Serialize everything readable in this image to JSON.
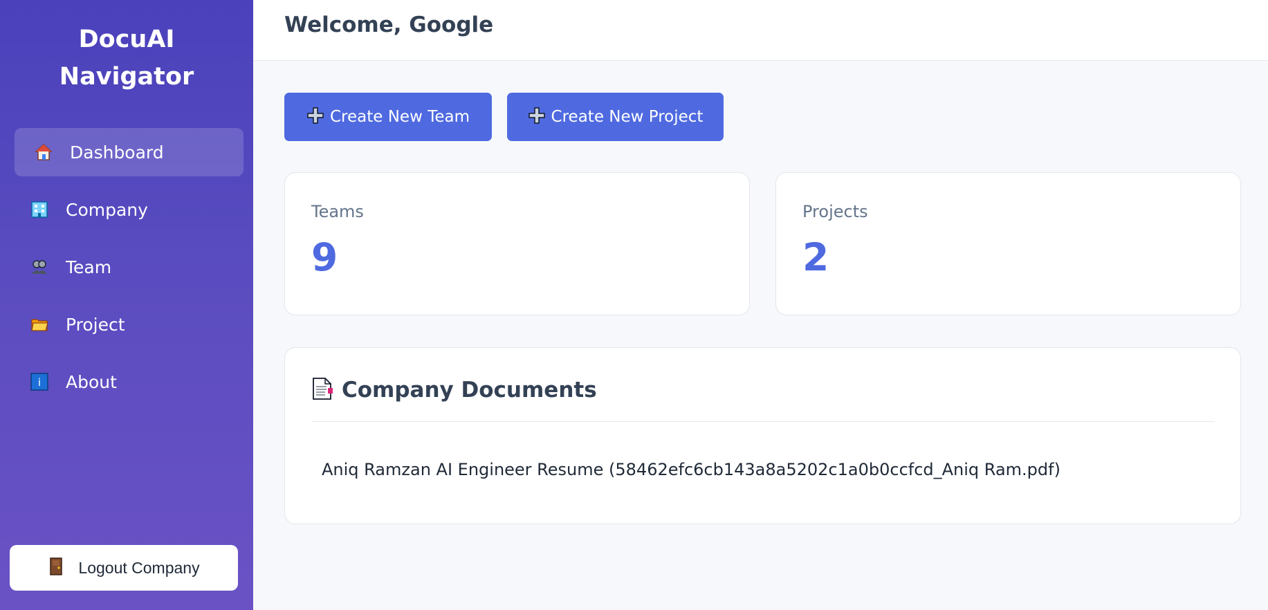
{
  "sidebar": {
    "brand_line1": "DocuAI",
    "brand_line2": "Navigator",
    "items": [
      {
        "label": "Dashboard",
        "icon": "house-icon",
        "active": true
      },
      {
        "label": "Company",
        "icon": "building-icon"
      },
      {
        "label": "Team",
        "icon": "people-icon"
      },
      {
        "label": "Project",
        "icon": "folder-icon"
      },
      {
        "label": "About",
        "icon": "info-icon"
      }
    ],
    "logout_label": "Logout Company",
    "logout_icon": "door-icon"
  },
  "header": {
    "welcome": "Welcome, Google"
  },
  "actions": {
    "create_team": "Create New Team",
    "create_project": "Create New Project"
  },
  "stats": {
    "teams_label": "Teams",
    "teams_value": "9",
    "projects_label": "Projects",
    "projects_value": "2"
  },
  "documents": {
    "title": "Company Documents",
    "items": [
      "Aniq Ramzan AI Engineer Resume (58462efc6cb143a8a5202c1a0b0ccfcd_Aniq Ram.pdf)"
    ]
  },
  "colors": {
    "accent": "#4f6ae0",
    "sidebar_top": "#4a41bb",
    "sidebar_bottom": "#6a52c4"
  }
}
